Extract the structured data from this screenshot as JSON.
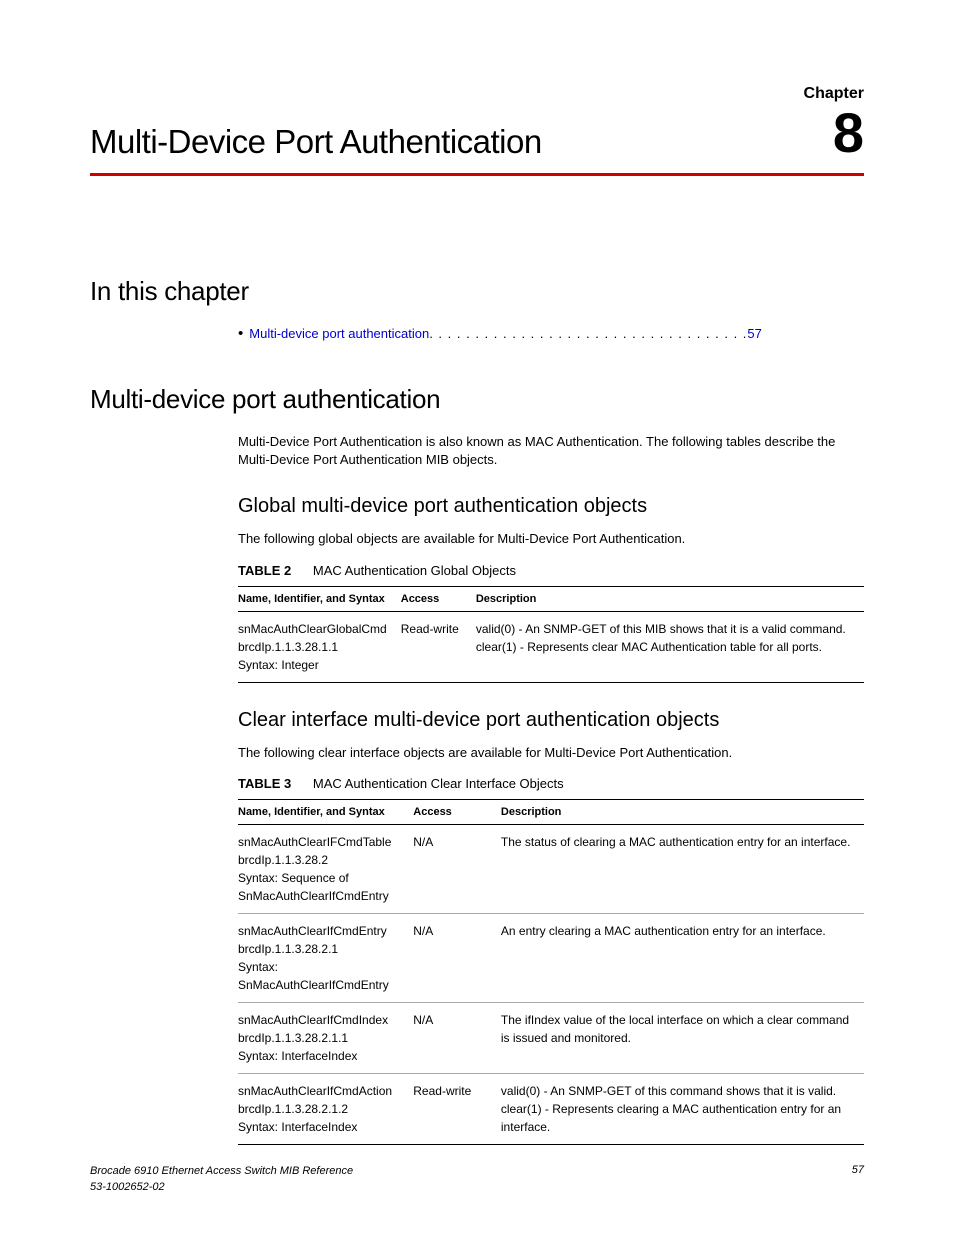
{
  "header": {
    "chapter_label": "Chapter",
    "chapter_number": "8",
    "title": "Multi-Device Port Authentication"
  },
  "in_this_chapter": {
    "heading": "In this chapter",
    "items": [
      {
        "label": "Multi-device port authentication",
        "dots": " . . . . . . . . . . . . . . . . . . . . . . . . . . . . . . . . . . . ",
        "page": "57"
      }
    ]
  },
  "section1": {
    "heading": "Multi-device port authentication",
    "intro": "Multi-Device Port Authentication is also known as MAC Authentication. The following tables describe the Multi-Device Port Authentication MIB objects."
  },
  "sub1": {
    "heading": "Global multi-device port authentication objects",
    "intro": "The following global objects are available for Multi-Device Port Authentication.",
    "table_label": "TABLE 2",
    "table_title": "MAC Authentication Global Objects",
    "columns": {
      "c1": "Name, Identifier, and Syntax",
      "c2": "Access",
      "c3": "Description"
    },
    "rows": [
      {
        "name": "snMacAuthClearGlobalCmd\nbrcdIp.1.1.3.28.1.1\nSyntax: Integer",
        "access": "Read-write",
        "desc": "valid(0) - An SNMP-GET of this MIB shows that it is a valid command.\nclear(1) - Represents clear MAC Authentication table for all ports."
      }
    ]
  },
  "sub2": {
    "heading": "Clear interface multi-device port authentication objects",
    "intro": "The following clear interface objects are available for Multi-Device Port Authentication.",
    "table_label": "TABLE 3",
    "table_title": "MAC Authentication Clear Interface Objects",
    "columns": {
      "c1": "Name, Identifier, and Syntax",
      "c2": "Access",
      "c3": "Description"
    },
    "rows": [
      {
        "name": "snMacAuthClearIFCmdTable\nbrcdIp.1.1.3.28.2\nSyntax: Sequence of SnMacAuthClearIfCmdEntry",
        "access": "N/A",
        "desc": "The status of clearing a MAC authentication entry for an interface."
      },
      {
        "name": "snMacAuthClearIfCmdEntry\nbrcdIp.1.1.3.28.2.1\nSyntax: SnMacAuthClearIfCmdEntry",
        "access": "N/A",
        "desc": "An entry clearing a MAC authentication entry for an interface."
      },
      {
        "name": "snMacAuthClearIfCmdIndex\nbrcdIp.1.1.3.28.2.1.1\nSyntax: InterfaceIndex",
        "access": "N/A",
        "desc": "The ifIndex value of the local interface on which a clear command is issued and monitored."
      },
      {
        "name": "snMacAuthClearIfCmdAction\nbrcdIp.1.1.3.28.2.1.2\nSyntax: InterfaceIndex",
        "access": "Read-write",
        "desc": "valid(0) - An SNMP-GET of this command shows that it is valid.\nclear(1) - Represents clearing a MAC authentication entry for an interface."
      }
    ]
  },
  "footer": {
    "line1": "Brocade 6910 Ethernet Access Switch MIB Reference",
    "line2": "53-1002652-02",
    "page": "57"
  }
}
